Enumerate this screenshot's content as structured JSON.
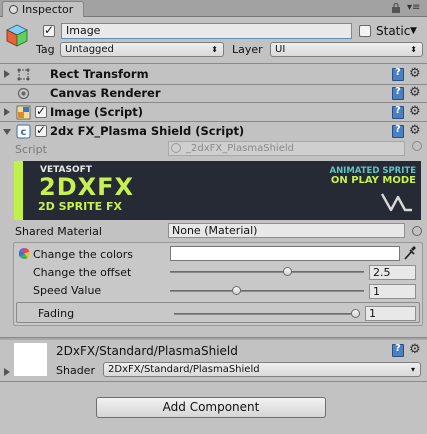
{
  "window": {
    "tab_label": "Inspector",
    "tab_icon": "info-icon",
    "lock_icon": "lock-icon",
    "menu_glyph": "▾≡"
  },
  "gameobject": {
    "active": true,
    "name": "Image",
    "static_label": "Static",
    "static_checked": false,
    "static_arrow": "▼",
    "tag_label": "Tag",
    "tag_value": "Untagged",
    "layer_label": "Layer",
    "layer_value": "UI"
  },
  "components": [
    {
      "title": "Rect Transform",
      "icon": "rect-transform-icon",
      "expanded": false
    },
    {
      "title": "Canvas Renderer",
      "icon": "canvas-renderer-icon",
      "expanded": false
    },
    {
      "title": "Image (Script)",
      "icon": "image-component-icon",
      "expanded": false,
      "enabled": true
    },
    {
      "title": "2dx FX_Plasma Shield (Script)",
      "icon": "script-icon",
      "expanded": true,
      "enabled": true
    }
  ],
  "plasma": {
    "script_label": "Script",
    "script_value": "_2dxFX_PlasmaShield",
    "banner": {
      "brand": "VETASOFT",
      "logo": "2DXFX",
      "sub": "2D SPRITE FX",
      "line1": "ANIMATED SPRITE",
      "line2": "ON PLAY MODE",
      "accent": "#c7f050",
      "teal": "#5ec6c6"
    },
    "shared_material_label": "Shared Material",
    "shared_material_value": "None (Material)",
    "props": [
      {
        "label": "Change the colors",
        "icon": "color-wheel-icon",
        "type": "color",
        "value": "#ffffff"
      },
      {
        "label": "Change the offset",
        "icon": "",
        "type": "slider",
        "value": "2.5",
        "fraction": 0.6
      },
      {
        "label": "Speed Value",
        "icon": "",
        "type": "slider",
        "value": "1",
        "fraction": 0.33
      },
      {
        "label": "Fading",
        "icon": "",
        "type": "slider",
        "value": "1",
        "fraction": 1.0
      }
    ]
  },
  "material": {
    "name": "2DxFX/Standard/PlasmaShield",
    "shader_label": "Shader",
    "shader_value": "2DxFX/Standard/PlasmaShield"
  },
  "add_component_label": "Add Component"
}
